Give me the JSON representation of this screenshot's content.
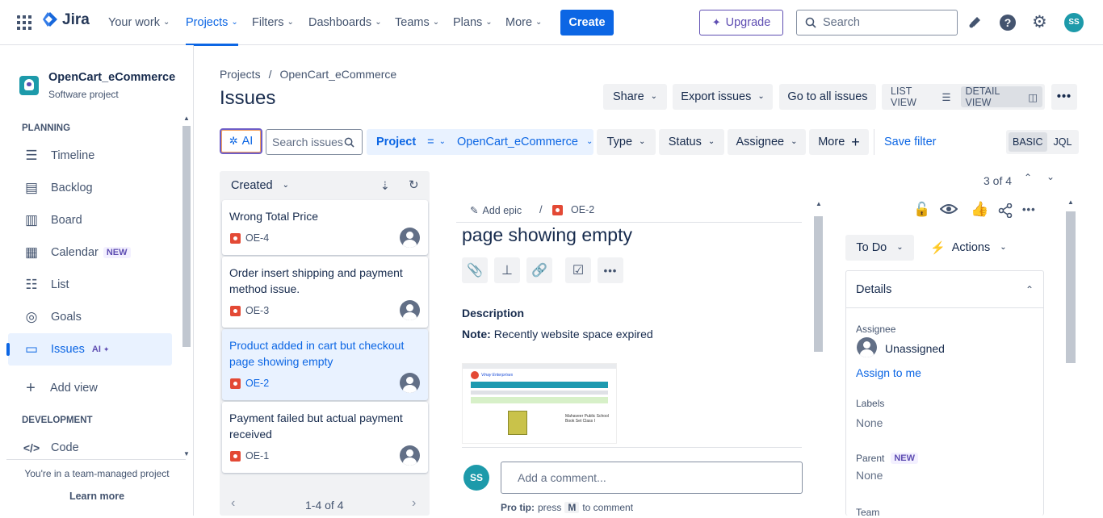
{
  "nav": {
    "logo": "Jira",
    "your_work": "Your work",
    "projects": "Projects",
    "filters": "Filters",
    "dashboards": "Dashboards",
    "teams": "Teams",
    "plans": "Plans",
    "more": "More",
    "create": "Create",
    "upgrade": "Upgrade",
    "search_placeholder": "Search",
    "avatar": "SS"
  },
  "sidebar": {
    "project_name": "OpenCart_eCommerce",
    "project_type": "Software project",
    "planning": "PLANNING",
    "timeline": "Timeline",
    "backlog": "Backlog",
    "board": "Board",
    "calendar": "Calendar",
    "calendar_badge": "NEW",
    "list": "List",
    "goals": "Goals",
    "issues": "Issues",
    "issues_badge": "AI",
    "add_view": "Add view",
    "development": "DEVELOPMENT",
    "code": "Code",
    "team_managed": "You're in a team-managed project",
    "learn_more": "Learn more"
  },
  "breadcrumb": {
    "projects": "Projects",
    "sep": "/",
    "project": "OpenCart_eCommerce"
  },
  "page_title": "Issues",
  "toolbar": {
    "share": "Share",
    "export": "Export issues",
    "goto_all": "Go to all issues",
    "list_view": "LIST VIEW",
    "detail_view": "DETAIL VIEW"
  },
  "filters": {
    "ai": "AI",
    "search_placeholder": "Search issues",
    "project_label": "Project",
    "project_op": "=",
    "project_value": "OpenCart_eCommerce",
    "type": "Type",
    "status": "Status",
    "assignee": "Assignee",
    "more": "More",
    "save_filter": "Save filter",
    "basic": "BASIC",
    "jql": "JQL"
  },
  "list": {
    "sort": "Created",
    "pagination": "1-4 of 4",
    "items": [
      {
        "title": "Wrong Total Price",
        "key": "OE-4"
      },
      {
        "title": "Order insert shipping and payment method issue.",
        "key": "OE-3"
      },
      {
        "title": "Product added in cart but checkout page showing empty",
        "key": "OE-2"
      },
      {
        "title": "Payment failed but actual payment received",
        "key": "OE-1"
      }
    ]
  },
  "detail": {
    "counter": "3 of 4",
    "add_epic": "Add epic",
    "key": "OE-2",
    "title": "page showing empty",
    "description_heading": "Description",
    "note_label": "Note:",
    "note_text": "Recently website space expired",
    "comment_avatar": "SS",
    "comment_placeholder": "Add a comment...",
    "pro_tip": "Pro tip:",
    "press": "press",
    "key_m": "M",
    "to_comment": "to comment",
    "status": "To Do",
    "actions": "Actions",
    "details": "Details",
    "assignee_label": "Assignee",
    "assignee_value": "Unassigned",
    "assign_to_me": "Assign to me",
    "labels_label": "Labels",
    "labels_value": "None",
    "parent_label": "Parent",
    "parent_badge": "NEW",
    "parent_value": "None",
    "team_label": "Team",
    "thumb_title": "Vinay Enterprises",
    "thumb_product": "Mahaveer Public School Book Set Class I"
  },
  "colors": {
    "brand": "#0c66e4",
    "bug": "#e34935",
    "selected_bg": "#e9f2ff",
    "upgrade": "#5e4db2"
  }
}
